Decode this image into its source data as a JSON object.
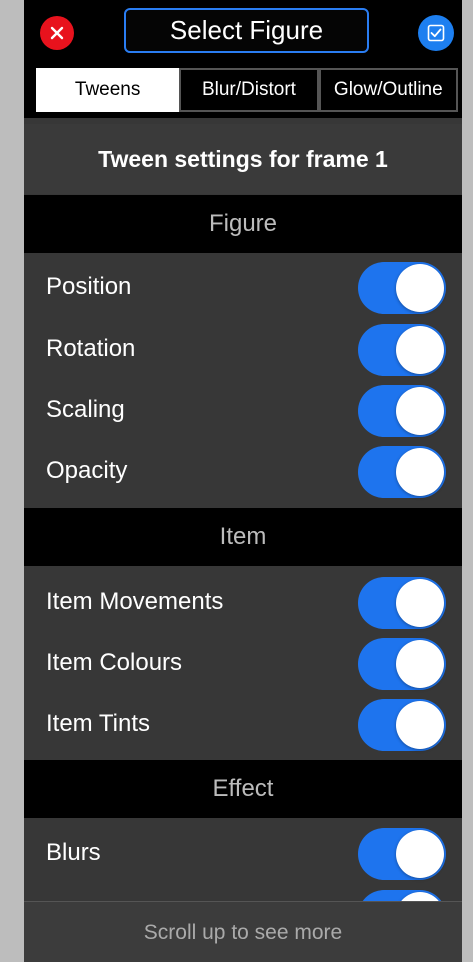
{
  "header": {
    "title": "Select Figure"
  },
  "tabs": [
    {
      "label": "Tweens",
      "active": true
    },
    {
      "label": "Blur/Distort",
      "active": false
    },
    {
      "label": "Glow/Outline",
      "active": false
    }
  ],
  "subtitle": "Tween settings for frame 1",
  "sections": {
    "figure": "Figure",
    "item": "Item",
    "effect": "Effect"
  },
  "rows": {
    "position": {
      "label": "Position",
      "on": true
    },
    "rotation": {
      "label": "Rotation",
      "on": true
    },
    "scaling": {
      "label": "Scaling",
      "on": true
    },
    "opacity": {
      "label": "Opacity",
      "on": true
    },
    "item_movements": {
      "label": "Item Movements",
      "on": true
    },
    "item_colours": {
      "label": "Item Colours",
      "on": true
    },
    "item_tints": {
      "label": "Item Tints",
      "on": true
    },
    "blurs": {
      "label": "Blurs",
      "on": true
    }
  },
  "footer": "Scroll up to see more",
  "colors": {
    "accent": "#1e74ee",
    "close": "#e8121d"
  }
}
